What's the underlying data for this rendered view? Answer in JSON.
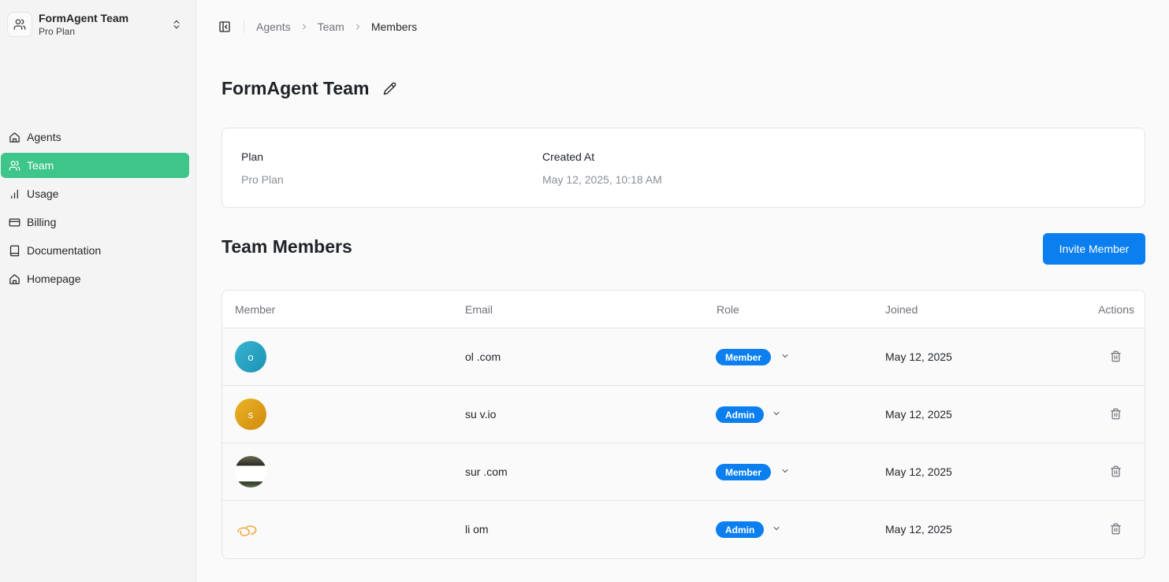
{
  "team": {
    "name": "FormAgent Team",
    "plan": "Pro Plan"
  },
  "nav": [
    {
      "label": "Agents",
      "icon": "home-icon",
      "active": false
    },
    {
      "label": "Team",
      "icon": "users-icon",
      "active": true
    },
    {
      "label": "Usage",
      "icon": "bar-chart-icon",
      "active": false
    },
    {
      "label": "Billing",
      "icon": "credit-card-icon",
      "active": false
    },
    {
      "label": "Documentation",
      "icon": "book-icon",
      "active": false
    },
    {
      "label": "Homepage",
      "icon": "home-icon",
      "active": false
    }
  ],
  "breadcrumb": [
    "Agents",
    "Team",
    "Members"
  ],
  "page_title": "FormAgent Team",
  "info": {
    "plan_label": "Plan",
    "plan_value": "Pro Plan",
    "created_label": "Created At",
    "created_value": "May 12, 2025, 10:18 AM"
  },
  "members_section": {
    "title": "Team Members",
    "invite_label": "Invite Member"
  },
  "table": {
    "headers": {
      "member": "Member",
      "email": "Email",
      "role": "Role",
      "joined": "Joined",
      "actions": "Actions"
    },
    "rows": [
      {
        "initial": "o",
        "email": "ol             .com",
        "role": "Member",
        "joined": "May 12, 2025"
      },
      {
        "initial": "s",
        "email": "su                 v.io",
        "role": "Admin",
        "joined": "May 12, 2025"
      },
      {
        "initial": "",
        "email": "sur                .com",
        "role": "Member",
        "joined": "May 12, 2025"
      },
      {
        "initial": "",
        "email": "li                 om",
        "role": "Admin",
        "joined": "May 12, 2025"
      }
    ]
  },
  "colors": {
    "accent_green": "#3ec58a",
    "primary_blue": "#0b7ff0"
  }
}
